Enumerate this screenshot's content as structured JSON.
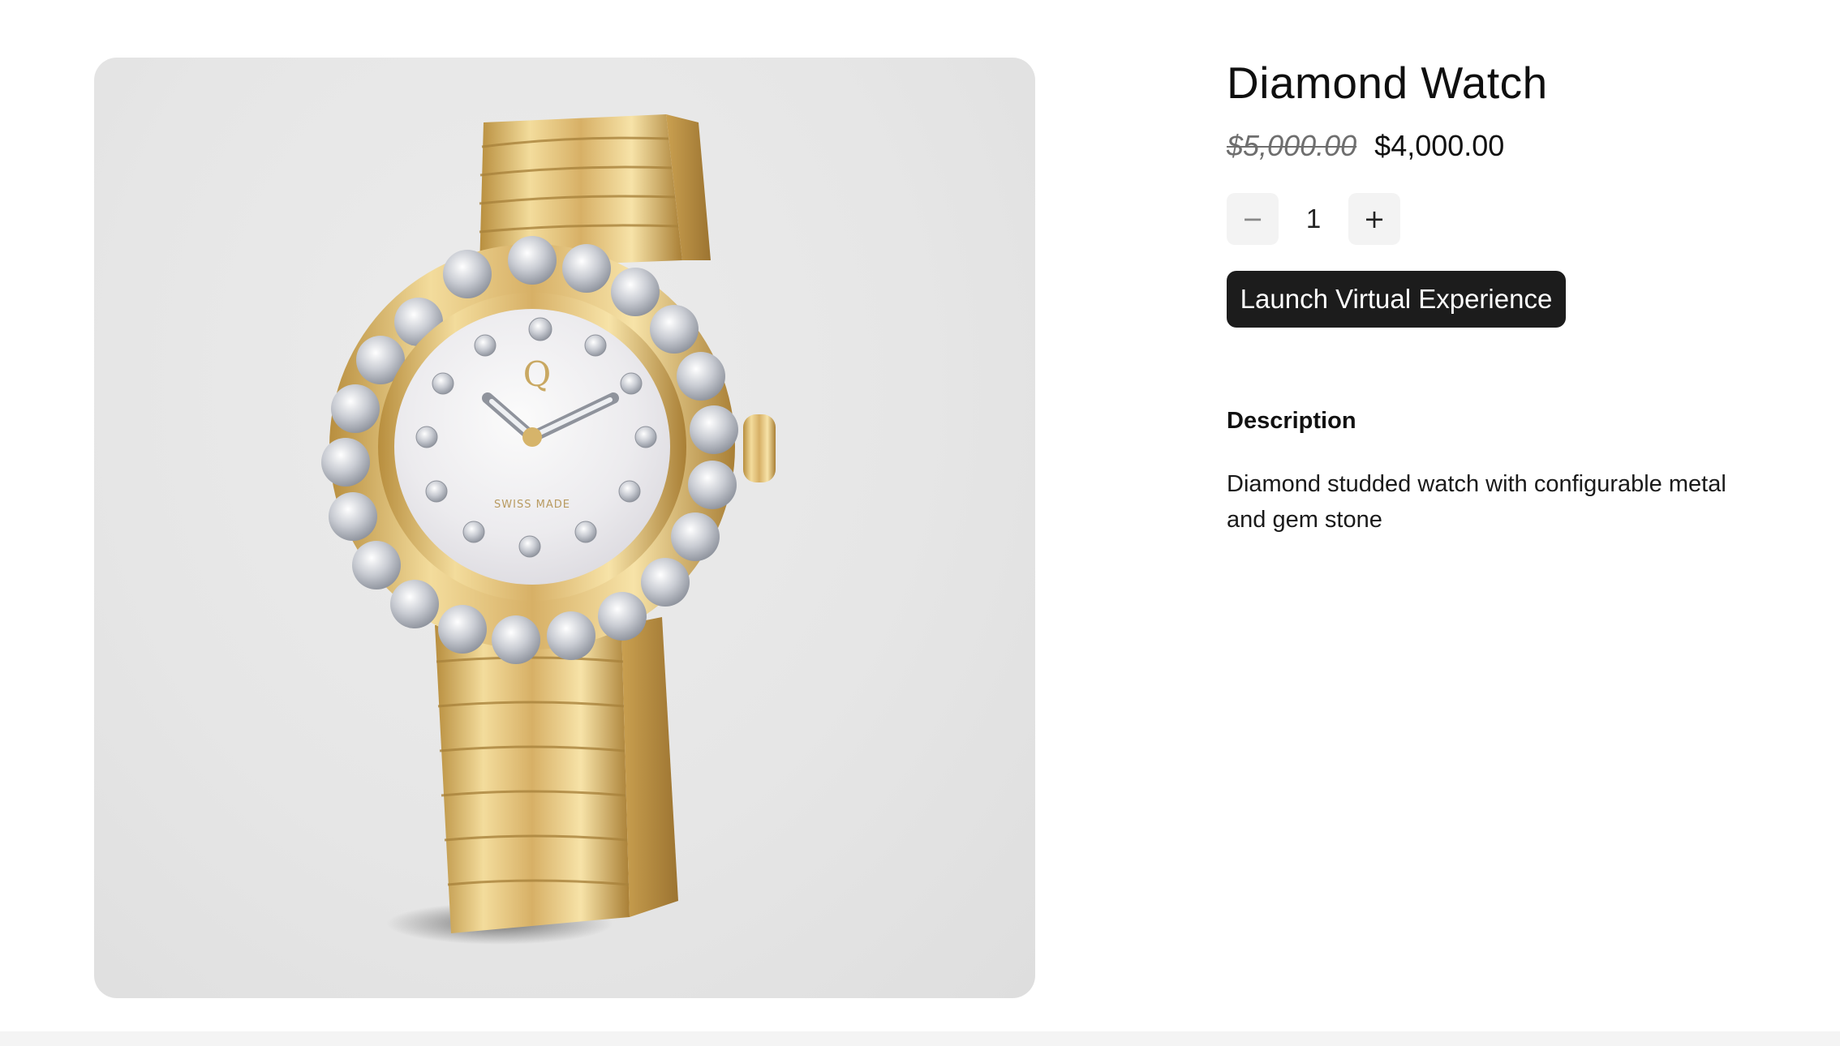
{
  "product": {
    "title": "Diamond Watch",
    "original_price": "$5,000.00",
    "sale_price": "$4,000.00",
    "image_alt": "Diamond Watch",
    "dial_logo": "Q",
    "dial_text": "SWISS MADE"
  },
  "quantity": {
    "decrement_label": "−",
    "value": "1",
    "increment_label": "+"
  },
  "actions": {
    "launch_label": "Launch Virtual Experience"
  },
  "description": {
    "heading": "Description",
    "text": "Diamond studded watch with configurable metal and gem stone"
  },
  "colors": {
    "button_bg": "#1c1c1c",
    "qty_button_bg": "#f3f3f3",
    "gold": "#d9b76a",
    "gallery_bg": "#e6e6e6"
  }
}
